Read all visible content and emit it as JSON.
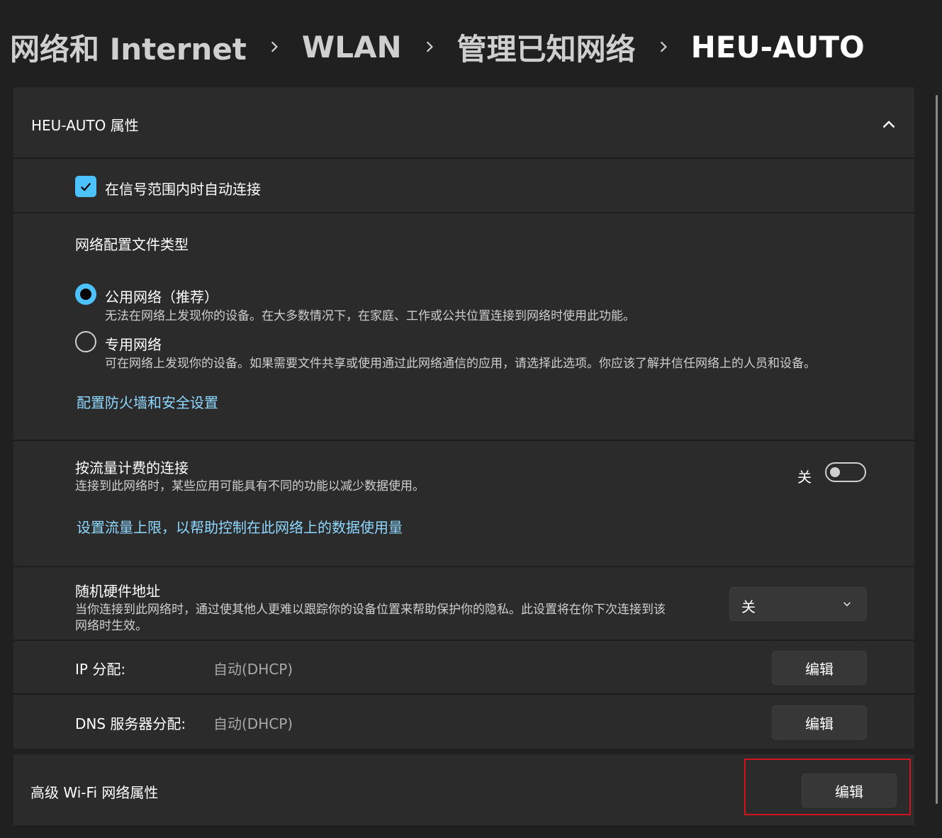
{
  "breadcrumb": {
    "items": [
      "网络和 Internet",
      "WLAN",
      "管理已知网络"
    ],
    "current": "HEU-AUTO"
  },
  "properties": {
    "header_title": "HEU-AUTO 属性",
    "auto_connect": {
      "label": "在信号范围内时自动连接",
      "checked": true
    },
    "profile_type": {
      "title": "网络配置文件类型",
      "public": {
        "label": "公用网络（推荐）",
        "description": "无法在网络上发现你的设备。在大多数情况下，在家庭、工作或公共位置连接到网络时使用此功能。",
        "selected": true
      },
      "private": {
        "label": "专用网络",
        "description": "可在网络上发现你的设备。如果需要文件共享或使用通过此网络通信的应用，请选择此选项。你应该了解并信任网络上的人员和设备。",
        "selected": false
      },
      "firewall_link": "配置防火墙和安全设置"
    },
    "metered": {
      "title": "按流量计费的连接",
      "description": "连接到此网络时，某些应用可能具有不同的功能以减少数据使用。",
      "toggle_state": "关",
      "data_limit_link": "设置流量上限，以帮助控制在此网络上的数据使用量"
    },
    "random_mac": {
      "title": "随机硬件地址",
      "description_line1": "当你连接到此网络时，通过使其他人更难以跟踪你的设备位置来帮助保护你的隐私。此设置将在你下次连接到该",
      "description_line2": "网络时生效。",
      "dropdown_value": "关"
    },
    "ip": {
      "label": "IP 分配:",
      "value": "自动(DHCP)",
      "button": "编辑"
    },
    "dns": {
      "label": "DNS 服务器分配:",
      "value": "自动(DHCP)",
      "button": "编辑"
    }
  },
  "advanced": {
    "label": "高级 Wi-Fi 网络属性",
    "button": "编辑"
  },
  "colors": {
    "accent": "#4cc2ff",
    "link": "#8fd8ff",
    "highlight": "#d0161c",
    "background": "#202020",
    "panel": "#2b2b2b"
  }
}
